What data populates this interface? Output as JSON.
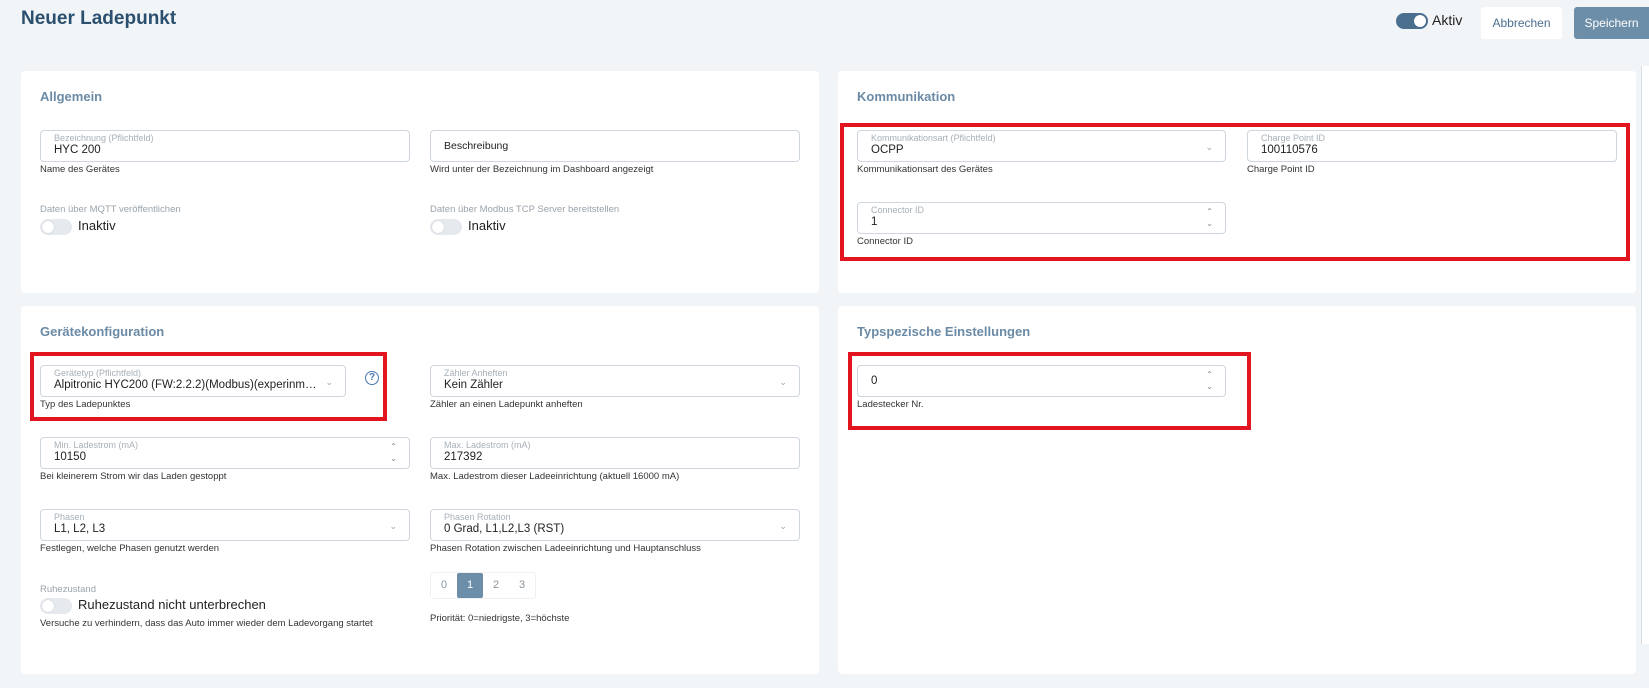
{
  "header": {
    "title": "Neuer Ladepunkt",
    "active_label": "Aktiv",
    "cancel_label": "Abbrechen",
    "save_label": "Speichern"
  },
  "allgemein": {
    "title": "Allgemein",
    "bezeichnung": {
      "label": "Bezeichnung (Pflichtfeld)",
      "value": "HYC 200",
      "hint": "Name des Gerätes"
    },
    "beschreibung": {
      "placeholder": "Beschreibung",
      "hint": "Wird unter der Bezeichnung im Dashboard angezeigt"
    },
    "mqtt": {
      "label": "Daten über MQTT veröffentlichen",
      "state": "Inaktiv"
    },
    "modbus": {
      "label": "Daten über Modbus TCP Server bereitstellen",
      "state": "Inaktiv"
    }
  },
  "kommunikation": {
    "title": "Kommunikation",
    "art": {
      "label": "Kommunikationsart (Pflichtfeld)",
      "value": "OCPP",
      "hint": "Kommunikationsart des Gerätes"
    },
    "charge_point": {
      "label": "Charge Point ID",
      "value": "100110576",
      "hint": "Charge Point ID"
    },
    "connector": {
      "label": "Connector ID",
      "value": "1",
      "hint": "Connector ID"
    }
  },
  "geraet": {
    "title": "Gerätekonfiguration",
    "typ": {
      "label": "Gerätetyp (Pflichtfeld)",
      "value": "Alpitronic HYC200 (FW:2.2.2)(Modbus)(experinmen...",
      "hint": "Typ des Ladepunktes"
    },
    "zaehler": {
      "label": "Zähler Anheften",
      "value": "Kein Zähler",
      "hint": "Zähler an einen Ladepunkt anheften"
    },
    "min_strom": {
      "label": "Min. Ladestrom (mA)",
      "value": "10150",
      "hint": "Bei kleinerem Strom wir das Laden gestoppt"
    },
    "max_strom": {
      "label": "Max. Ladestrom (mA)",
      "value": "217392",
      "hint": "Max. Ladestrom dieser Ladeeinrichtung (aktuell 16000 mA)"
    },
    "phasen": {
      "label": "Phasen",
      "value": "L1, L2, L3",
      "hint": "Festlegen, welche Phasen genutzt werden"
    },
    "rotation": {
      "label": "Phasen Rotation",
      "value": "0 Grad, L1,L2,L3 (RST)",
      "hint": "Phasen Rotation zwischen Ladeeinrichtung und Hauptanschluss"
    },
    "ruhe": {
      "label": "Ruhezustand",
      "state": "Ruhezustand nicht unterbrechen",
      "hint": "Versuche zu verhindern, dass das Auto immer wieder dem Ladevorgang startet"
    },
    "prio": {
      "options": [
        "0",
        "1",
        "2",
        "3"
      ],
      "selected": "1",
      "hint": "Priorität: 0=niedrigste, 3=höchste"
    }
  },
  "typ": {
    "title": "Typspezische Einstellungen",
    "ladestecker": {
      "value": "0",
      "hint": "Ladestecker Nr."
    }
  },
  "colors": {
    "accent": "#4a6f8f",
    "highlight": "#e1141f",
    "title": "#2b4f6e"
  },
  "icons": {
    "select": "chevron-down-icon",
    "number": "spinner-icon",
    "help": "help-circle-icon"
  }
}
